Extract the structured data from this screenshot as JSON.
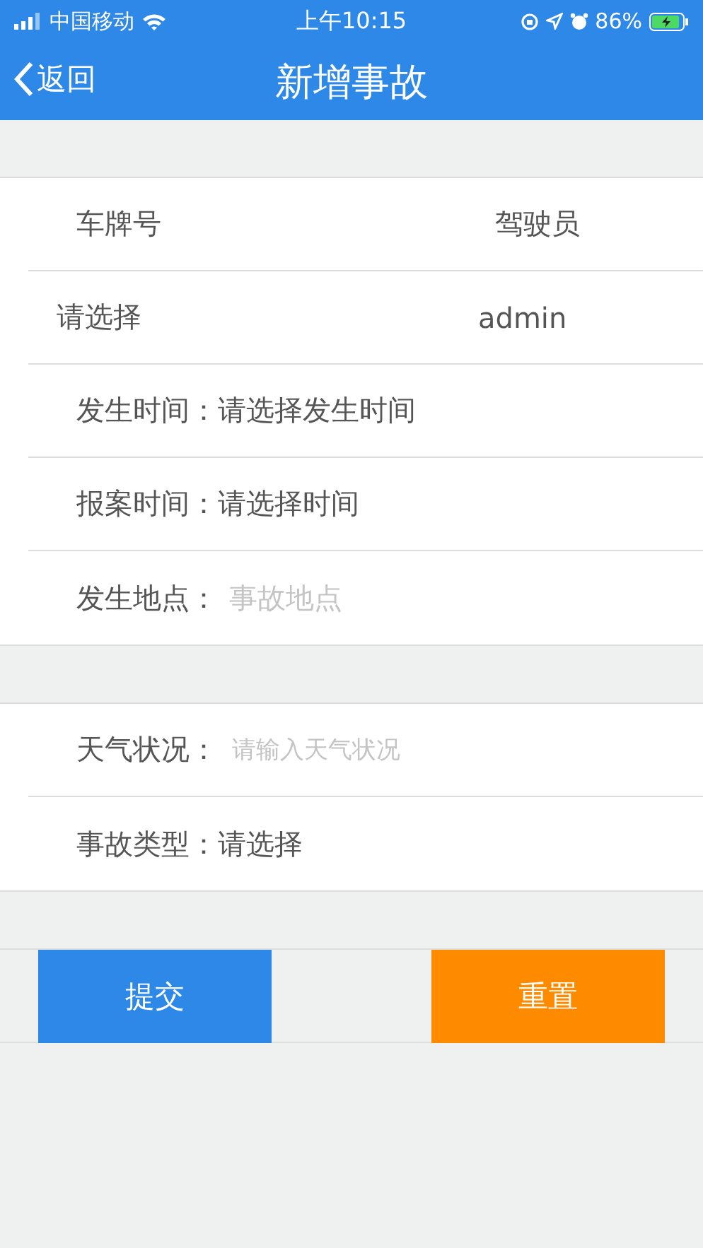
{
  "status_bar": {
    "carrier": "中国移动",
    "time": "上午10:15",
    "battery": "86%"
  },
  "nav": {
    "back": "返回",
    "title": "新增事故"
  },
  "vehicle_driver": {
    "columns": [
      "车牌号",
      "驾驶员"
    ],
    "values": [
      "请选择",
      "admin"
    ]
  },
  "sections": [
    {
      "rows": [
        {
          "kind": "select",
          "label": "发生时间：",
          "value": "请选择发生时间"
        },
        {
          "kind": "select",
          "label": "报案时间：",
          "value": "请选择时间"
        },
        {
          "kind": "input",
          "label": "发生地点：",
          "placeholder": "事故地点"
        }
      ]
    },
    {
      "rows": [
        {
          "kind": "input",
          "label": "天气状况：",
          "placeholder": "请输入天气状况"
        },
        {
          "kind": "select",
          "label": "事故类型：",
          "value": "请选择"
        }
      ]
    }
  ],
  "buttons": [
    {
      "label": "提交",
      "kind": "primary"
    },
    {
      "label": "重置",
      "kind": "warning"
    }
  ]
}
